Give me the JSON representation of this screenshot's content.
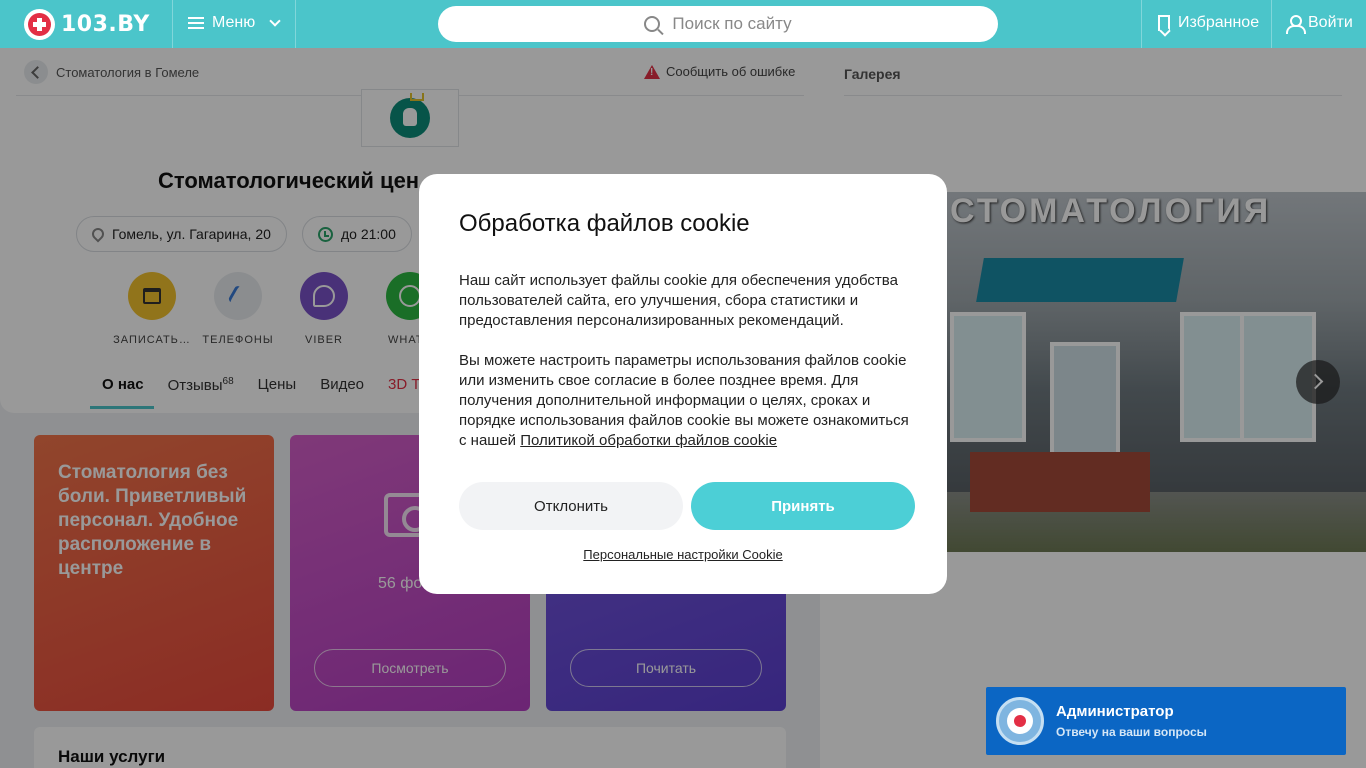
{
  "header": {
    "logo_text": "103.BY",
    "menu_label": "Меню",
    "search_placeholder": "Поиск по сайту",
    "favorites_label": "Избранное",
    "login_label": "Войти",
    "accent_color": "#4bc5ca"
  },
  "page": {
    "breadcrumb": "Стоматология в Гомеле",
    "report_error": "Сообщить об ошибке",
    "clinic_title": "Стоматологический цен",
    "address": "Гомель, ул. Гагарина, 20",
    "hours": "до 21:00",
    "actions": [
      {
        "label": "ЗАПИСАТЬ…",
        "icon": "calendar-icon",
        "color": "#f2c12e"
      },
      {
        "label": "ТЕЛЕФОНЫ",
        "icon": "phone-icon",
        "color": "#e8ebee"
      },
      {
        "label": "VIBER",
        "icon": "viber-icon",
        "color": "#7b52c9"
      },
      {
        "label": "WHATS",
        "icon": "whatsapp-icon",
        "color": "#2cb742"
      }
    ],
    "tabs": [
      {
        "label": "О нас",
        "active": true
      },
      {
        "label": "Отзывы",
        "count": "68"
      },
      {
        "label": "Цены"
      },
      {
        "label": "Видео"
      },
      {
        "label": "3D Т"
      }
    ]
  },
  "cards": {
    "promo_text": "Стоматология без боли. Приветливый персонал. Удобное расположение в центре",
    "photos_text": "56 фо",
    "photos_button": "Посмотреть",
    "read_button": "Почитать"
  },
  "services_title": "Наши услуги",
  "gallery": {
    "label": "Галерея",
    "sign_text": "СТОМАТОЛОГИЯ"
  },
  "cookie_modal": {
    "title": "Обработка файлов cookie",
    "paragraph1": "Наш сайт использует файлы cookie для обеспечения удобства пользователей сайта, его улучшения, сбора статистики и предоставления персонализированных рекомендаций.",
    "paragraph2": "Вы можете настроить параметры использования файлов cookie или изменить свое согласие в более позднее время. Для получения дополнительной информации о целях, сроках и порядке использования файлов cookie вы можете ознакомиться с нашей ",
    "policy_link": "Политикой обработки файлов cookie",
    "decline_label": "Отклонить",
    "accept_label": "Принять",
    "settings_link": "Персональные настройки Cookie"
  },
  "chat": {
    "title": "Администратор",
    "subtitle": "Отвечу на ваши вопросы"
  }
}
